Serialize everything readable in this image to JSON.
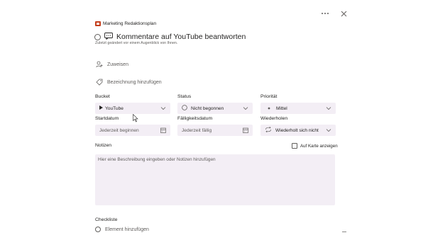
{
  "header": {
    "plan_name": "Marketing Redaktionsplan",
    "task_title": "Kommentare auf YouTube beantworten",
    "last_modified": "Zuletzt geändert vor einem Augenblick von Ihnen."
  },
  "actions": {
    "assign": "Zuweisen",
    "add_label": "Bezeichnung hinzufügen"
  },
  "fields": {
    "bucket": {
      "label": "Bucket",
      "value": "YouTube"
    },
    "status": {
      "label": "Status",
      "value": "Nicht begonnen"
    },
    "priority": {
      "label": "Priorität",
      "value": "Mittel"
    },
    "start_date": {
      "label": "Startdatum",
      "placeholder": "Jederzeit beginnen"
    },
    "due_date": {
      "label": "Fälligkeitsdatum",
      "placeholder": "Jederzeit fällig"
    },
    "repeat": {
      "label": "Wiederholen",
      "value": "Wiederholt sich nicht"
    }
  },
  "notes": {
    "label": "Notizen",
    "show_on_card": "Auf Karte anzeigen",
    "placeholder": "Hier eine Beschreibung eingeben oder Notizen hinzufügen"
  },
  "checklist": {
    "label": "Checkliste",
    "add_item": "Element hinzufügen"
  },
  "icons": {
    "more": "more-icon",
    "close": "close-icon"
  }
}
